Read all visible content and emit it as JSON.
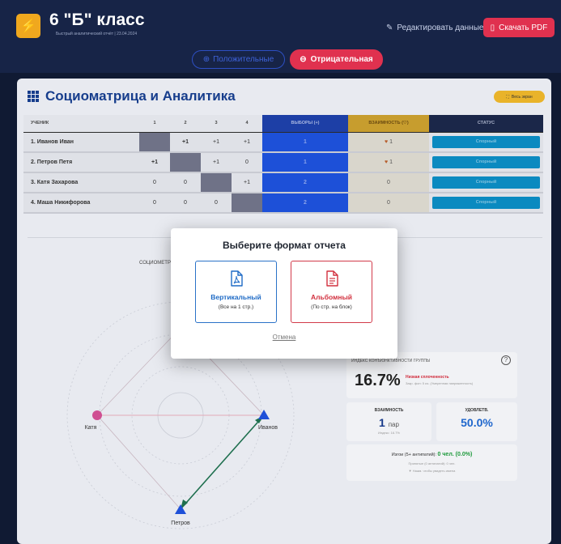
{
  "header": {
    "class_title": "6 \"Б\" класс",
    "subtitle": "Быстрый аналитический отчёт | 23.04.2024",
    "edit_label": "Редактировать данные",
    "pdf_label": "Скачать PDF"
  },
  "toggle": {
    "positive_label": "Положительные",
    "negative_label": "Отрицательная"
  },
  "card": {
    "title": "Социоматрица и Аналитика",
    "fullscreen_label": "Весь экран"
  },
  "matrix": {
    "headers": {
      "student": "УЧЕНИК",
      "cols": [
        "1",
        "2",
        "3",
        "4"
      ],
      "choices": "ВЫБОРЫ (+)",
      "mutual": "ВЗАИМНОСТЬ (♡)",
      "status": "СТАТУС"
    },
    "rows": [
      {
        "name": "1. Иванов Иван",
        "cells": [
          "",
          "+1",
          "+1",
          "+1"
        ],
        "choices": "1",
        "mutual": "1",
        "status": "Спорный"
      },
      {
        "name": "2. Петров Петя",
        "cells": [
          "+1",
          "",
          "+1",
          "0"
        ],
        "choices": "1",
        "mutual": "1",
        "status": "Спорный"
      },
      {
        "name": "3. Катя Захарова",
        "cells": [
          "0",
          "0",
          "",
          "+1"
        ],
        "choices": "2",
        "mutual": "0",
        "status": "Спорный"
      },
      {
        "name": "4. Маша Никифорова",
        "cells": [
          "0",
          "0",
          "0",
          ""
        ],
        "choices": "2",
        "mutual": "0",
        "status": "Спорный"
      }
    ]
  },
  "sociogram": {
    "caption": "СОЦИОМЕТР",
    "nodes": {
      "katya": "Катя",
      "ivanov": "Иванов",
      "petrov": "Петров"
    }
  },
  "index": {
    "label": "ИНДЕКС КОНЪЮНКТИВНОСТИ ГРУППЫ",
    "help": "?",
    "value": "16.7%",
    "level": "Низкая сплоченность",
    "note": "Закр. фон: 5 из. (Умеренная напряженность)"
  },
  "mutuality": {
    "label": "ВЗАИМНОСТЬ",
    "value": "1",
    "unit": "пар",
    "sub": "Индекс: 16.7%"
  },
  "satisfaction": {
    "label": "УДОВЛЕТВ.",
    "value": "50.0%"
  },
  "results": {
    "prefix": "Изгои (5+ антипатий):",
    "value": "0 чел. (0.0%)",
    "sub": "Принятые (0 антипатий): 0 чел.",
    "hint": "▼ Нажм. чтобы увидеть имена"
  },
  "modal": {
    "title": "Выберите формат отчета",
    "vertical_title": "Вертикальный",
    "vertical_sub": "(Все на 1 стр.)",
    "landscape_title": "Альбомный",
    "landscape_sub": "(По стр. на блок)",
    "cancel": "Отмена"
  },
  "colors": {
    "accent_blue": "#1f6bc6",
    "accent_red": "#d2313f",
    "brand_orange": "#f0a81e",
    "header_bg": "#172447"
  }
}
